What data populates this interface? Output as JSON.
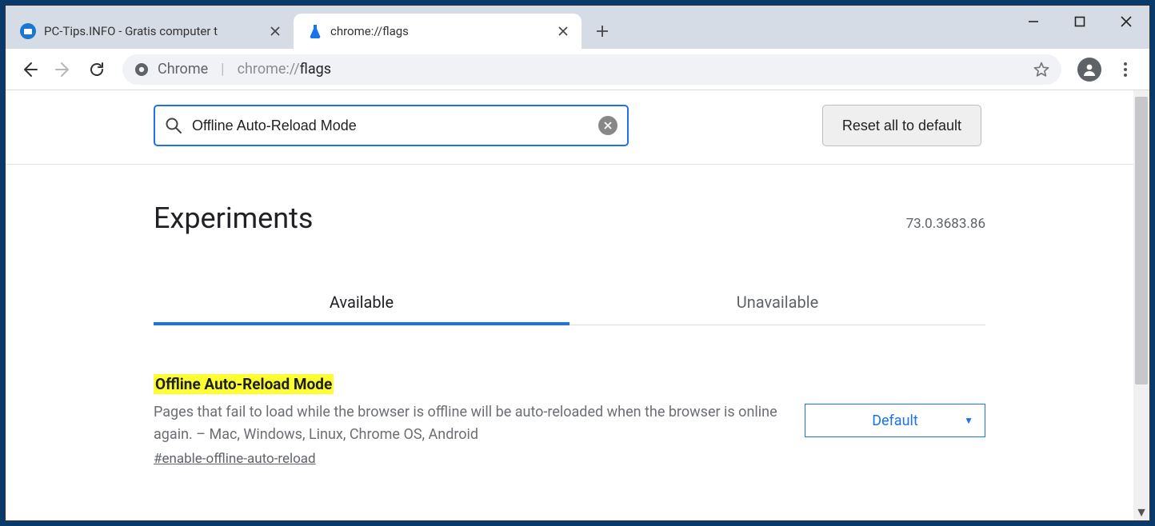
{
  "tabs": {
    "inactive": {
      "title": "PC-Tips.INFO - Gratis computer t"
    },
    "active": {
      "title": "chrome://flags"
    }
  },
  "omnibox": {
    "prefix": "Chrome",
    "url_scheme": "chrome://",
    "url_path": "flags"
  },
  "flags": {
    "search_value": "Offline Auto-Reload Mode",
    "reset_label": "Reset all to default",
    "page_title": "Experiments",
    "version": "73.0.3683.86",
    "tab_available": "Available",
    "tab_unavailable": "Unavailable",
    "entry": {
      "title": "Offline Auto-Reload Mode",
      "description": "Pages that fail to load while the browser is offline will be auto-reloaded when the browser is online again. – Mac, Windows, Linux, Chrome OS, Android",
      "hash": "#enable-offline-auto-reload",
      "select_value": "Default"
    }
  }
}
